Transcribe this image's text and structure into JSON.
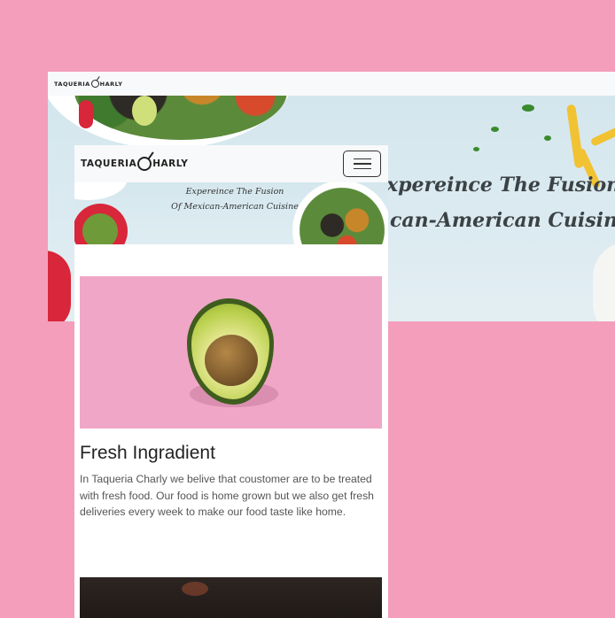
{
  "brand": {
    "logo_text_before": "TAQUERIA",
    "logo_text_after": "HARLY"
  },
  "desktop": {
    "hero_line1": "xpereince The Fusion",
    "hero_line2": "can-American Cuisine"
  },
  "mobile": {
    "menu_icon": "hamburger-icon",
    "hero_line1": "Expereince The Fusion",
    "hero_line2": "Of Mexican-American Cuisine",
    "card1": {
      "title": "Fresh Ingradient",
      "body": "In Taqueria Charly we belive that coustomer are to be treated with fresh food. Our food is home grown but we also get fresh deliveries every week to make our food taste like home.",
      "image": "avocado-photo"
    },
    "card2": {
      "image": "kitchen-photo"
    }
  },
  "colors": {
    "background": "#f49ebc",
    "navbar": "#f8f9fa",
    "hero": "#d9e9ef",
    "avocado_bg": "#f0a6c6"
  }
}
